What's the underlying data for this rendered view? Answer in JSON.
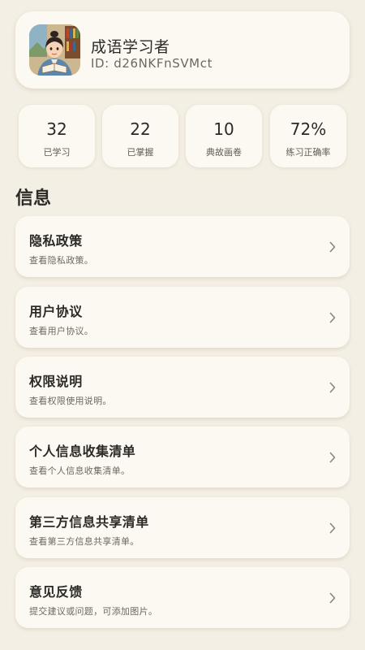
{
  "profile": {
    "name": "成语学习者",
    "id_text": "ID: d26NKFnSVMct",
    "avatar_icon": "scholar-reading-avatar"
  },
  "stats": [
    {
      "value": "32",
      "label": "已学习"
    },
    {
      "value": "22",
      "label": "已掌握"
    },
    {
      "value": "10",
      "label": "典故画卷"
    },
    {
      "value": "72%",
      "label": "练习正确率"
    }
  ],
  "section": {
    "title": "信息"
  },
  "menu": [
    {
      "title": "隐私政策",
      "subtitle": "查看隐私政策。"
    },
    {
      "title": "用户协议",
      "subtitle": "查看用户协议。"
    },
    {
      "title": "权限说明",
      "subtitle": "查看权限使用说明。"
    },
    {
      "title": "个人信息收集清单",
      "subtitle": "查看个人信息收集清单。"
    },
    {
      "title": "第三方信息共享清单",
      "subtitle": "查看第三方信息共享清单。"
    },
    {
      "title": "意见反馈",
      "subtitle": "提交建议或问题，可添加图片。"
    }
  ],
  "icons": {
    "chevron": "chevron-right-icon"
  },
  "colors": {
    "background": "#f4efe4",
    "card": "#fcf9f2",
    "text_primary": "#2c2a26",
    "text_secondary": "#6d6860"
  }
}
